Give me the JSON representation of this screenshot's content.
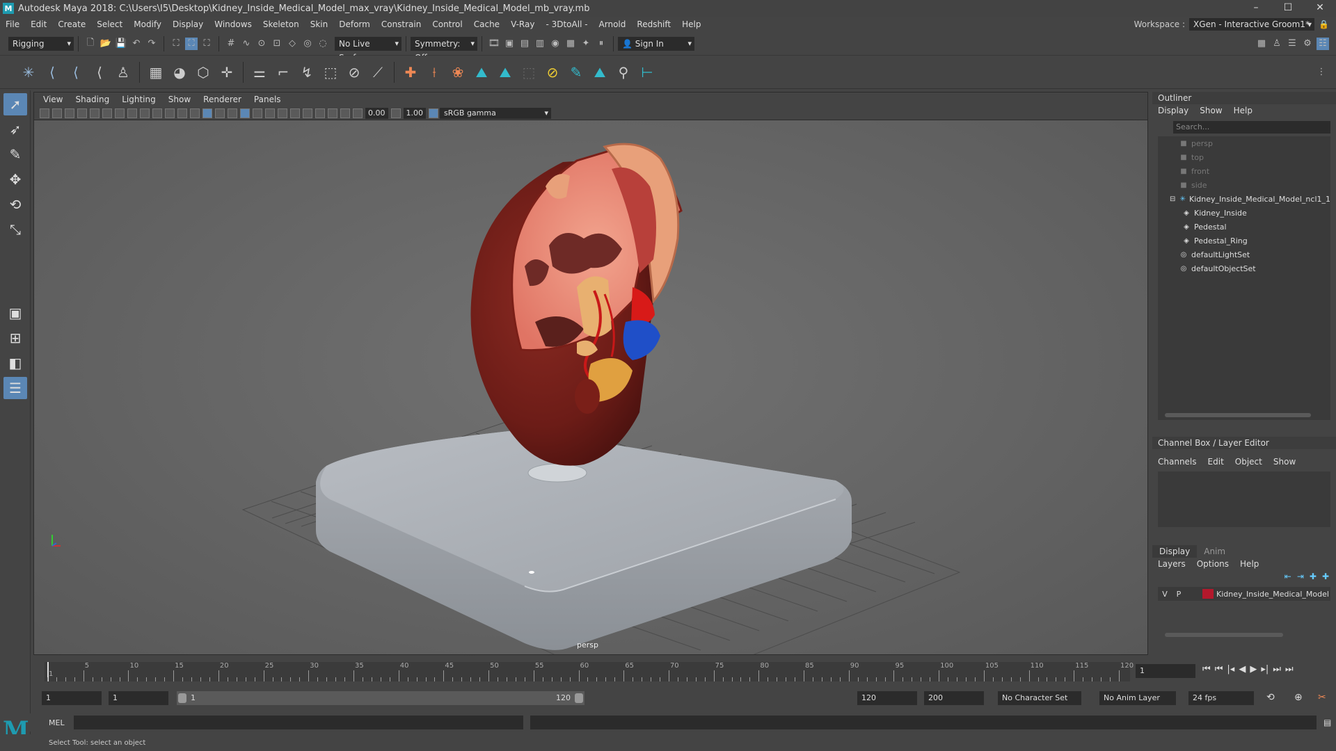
{
  "titlebar": {
    "title": "Autodesk Maya 2018: C:\\Users\\I5\\Desktop\\Kidney_Inside_Medical_Model_max_vray\\Kidney_Inside_Medical_Model_mb_vray.mb",
    "app_icon": "M"
  },
  "window_buttons": {
    "minimize": "–",
    "maximize": "☐",
    "close": "✕"
  },
  "menubar": [
    "File",
    "Edit",
    "Create",
    "Select",
    "Modify",
    "Display",
    "Windows",
    "Skeleton",
    "Skin",
    "Deform",
    "Constrain",
    "Control",
    "Cache",
    "V-Ray",
    "- 3DtoAll -",
    "Arnold",
    "Redshift",
    "Help"
  ],
  "workspace": {
    "label": "Workspace :",
    "value": "XGen - Interactive Groom1*"
  },
  "statusline": {
    "mode": "Rigging",
    "live_surface": "No Live Surface",
    "symmetry": "Symmetry: Off",
    "sign_in": "Sign In"
  },
  "viewport": {
    "menu": [
      "View",
      "Shading",
      "Lighting",
      "Show",
      "Renderer",
      "Panels"
    ],
    "exposure": "0.00",
    "gamma": "1.00",
    "color_space": "sRGB gamma",
    "camera_label": "persp"
  },
  "outliner": {
    "title": "Outliner",
    "menu": [
      "Display",
      "Show",
      "Help"
    ],
    "search_placeholder": "Search...",
    "items": [
      {
        "label": "persp",
        "icon": "camera-icon",
        "dim": true
      },
      {
        "label": "top",
        "icon": "camera-icon",
        "dim": true
      },
      {
        "label": "front",
        "icon": "camera-icon",
        "dim": true
      },
      {
        "label": "side",
        "icon": "camera-icon",
        "dim": true
      },
      {
        "label": "Kidney_Inside_Medical_Model_ncl1_1",
        "icon": "group-icon",
        "dim": false
      },
      {
        "label": "Kidney_Inside",
        "icon": "mesh-icon",
        "dim": false
      },
      {
        "label": "Pedestal",
        "icon": "mesh-icon",
        "dim": false
      },
      {
        "label": "Pedestal_Ring",
        "icon": "mesh-icon",
        "dim": false
      },
      {
        "label": "defaultLightSet",
        "icon": "set-icon",
        "dim": false
      },
      {
        "label": "defaultObjectSet",
        "icon": "set-icon",
        "dim": false
      }
    ]
  },
  "channel_box": {
    "title": "Channel Box / Layer Editor",
    "menu": [
      "Channels",
      "Edit",
      "Object",
      "Show"
    ]
  },
  "layer_editor": {
    "tabs": [
      "Display",
      "Anim"
    ],
    "menu": [
      "Layers",
      "Options",
      "Help"
    ],
    "layer": {
      "v": "V",
      "p": "P",
      "name": "Kidney_Inside_Medical_Model",
      "color": "#b3182c"
    }
  },
  "timeline": {
    "ticks": [
      "5",
      "10",
      "15",
      "20",
      "25",
      "30",
      "35",
      "40",
      "45",
      "50",
      "55",
      "60",
      "65",
      "70",
      "75",
      "80",
      "85",
      "90",
      "95",
      "100",
      "105",
      "110",
      "115",
      "120"
    ],
    "start_marker": "1",
    "current_frame": "1"
  },
  "range": {
    "start": "1",
    "playback_start": "1",
    "range_start": "1",
    "range_end": "120",
    "playback_end": "120",
    "end": "200",
    "character_set": "No Character Set",
    "anim_layer": "No Anim Layer",
    "fps": "24 fps"
  },
  "cmdline": {
    "label": "MEL"
  },
  "helpline": {
    "text": "Select Tool: select an object"
  }
}
